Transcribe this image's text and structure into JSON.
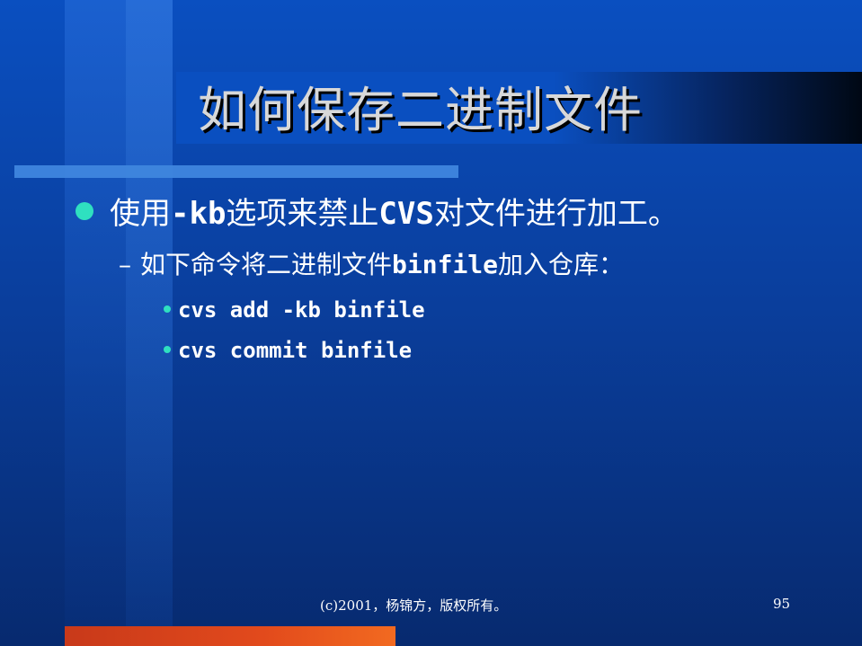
{
  "slide": {
    "title": "如何保存二进制文件",
    "bullet1": {
      "prefix": "使用",
      "code": "-kb",
      "middle": "选项来禁止",
      "code2": "CVS",
      "suffix": "对文件进行加工。"
    },
    "bullet2": {
      "dash": "–",
      "prefix": "如下命令将二进制文件",
      "code": "binfile",
      "suffix": "加入仓库："
    },
    "commands": [
      "cvs add -kb binfile",
      "cvs commit binfile"
    ],
    "footer": "(c)2001，杨锦方，版权所有。",
    "page_number": "95"
  },
  "colors": {
    "background": "#0a4fc0",
    "bullet": "#2fe0c0",
    "accent_stripe": "#3f86de",
    "bottom_bar": "#e24a1c",
    "title_text": "#d8d8d8"
  }
}
